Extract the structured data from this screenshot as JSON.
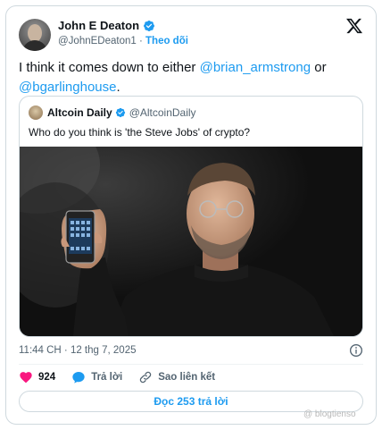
{
  "author": {
    "name": "John E Deaton",
    "handle": "@JohnEDeaton1",
    "separator": "·",
    "follow_label": "Theo dõi"
  },
  "tweet": {
    "text_before": "I think it comes down to either ",
    "mention_1": "@brian_armstrong",
    "text_middle": " or ",
    "mention_2": "@bgarlinghouse",
    "text_after": "."
  },
  "quote": {
    "name": "Altcoin Daily",
    "handle": "@AltcoinDaily",
    "text": "Who do you think is 'the Steve Jobs' of crypto?"
  },
  "timestamp": "11:44 CH · 12 thg 7, 2025",
  "actions": {
    "like_count": "924",
    "reply_label": "Trả lời",
    "copy_link_label": "Sao liên kết"
  },
  "read_replies_label": "Đọc 253 trả lời",
  "watermark": "@ blogtienso",
  "colors": {
    "accent": "#1d9bf0",
    "like": "#f91880",
    "text": "#0f1419",
    "muted": "#536471",
    "border": "#cfd9de"
  },
  "icons": {
    "verified": "verified-badge-icon",
    "logo": "x-logo-icon",
    "info": "info-icon",
    "like": "heart-icon",
    "reply": "speech-bubble-icon",
    "copy_link": "link-icon"
  }
}
